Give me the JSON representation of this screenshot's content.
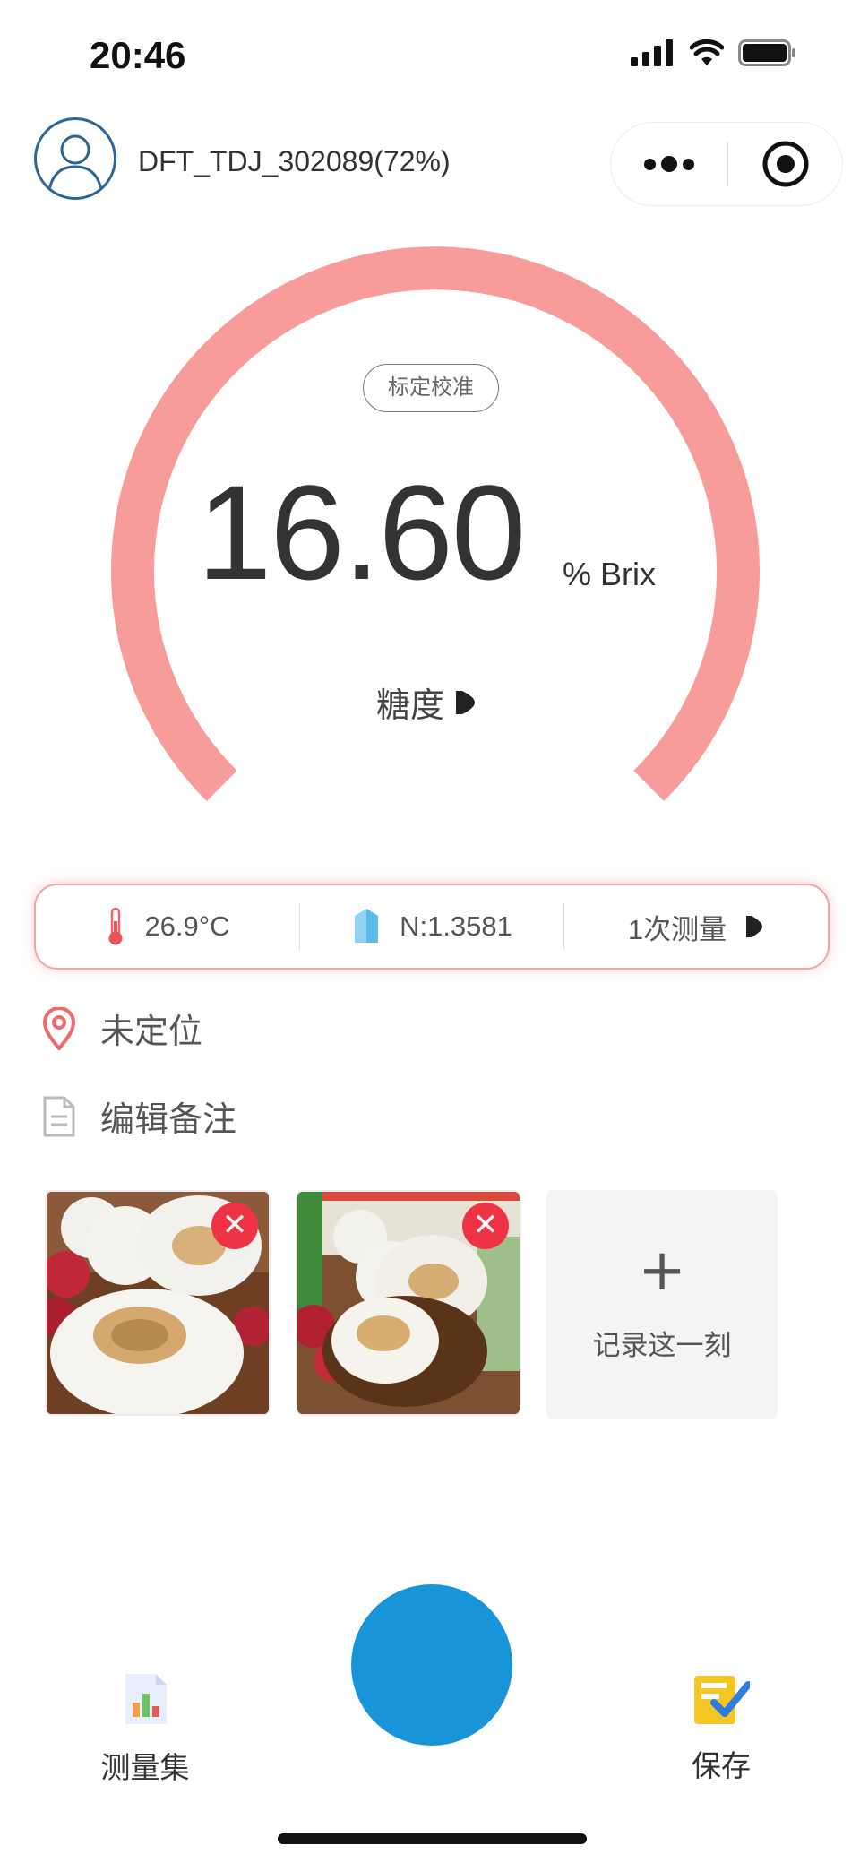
{
  "status_bar": {
    "time": "20:46"
  },
  "header": {
    "device_name": "DFT_TDJ_302089(72%)",
    "avatar_icon": "user-avatar-icon",
    "menu_icon": "more-dots-icon",
    "close_icon": "target-circle-icon"
  },
  "gauge": {
    "calibrate_label": "标定校准",
    "reading": "16.60",
    "unit": "% Brix",
    "mode_label": "糖度",
    "arc_color": "#f79c9b"
  },
  "info_bar": {
    "temperature": "26.9°C",
    "refractive_index": "N:1.3581",
    "measure_count": "1次测量"
  },
  "location": {
    "label": "未定位"
  },
  "note": {
    "label": "编辑备注"
  },
  "photos": {
    "count": 2,
    "add_label": "记录这一刻",
    "add_symbol": "+"
  },
  "bottom_bar": {
    "left_label": "测量集",
    "right_label": "保存",
    "measure_button_color": "#1895d8"
  }
}
